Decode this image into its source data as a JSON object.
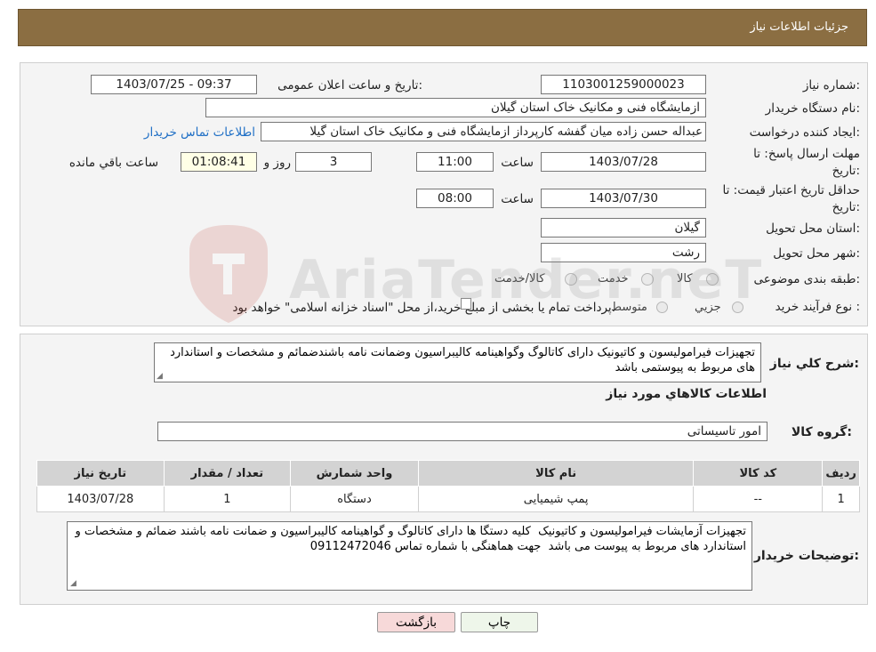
{
  "header": {
    "title": "جزئیات اطلاعات نیاز"
  },
  "form": {
    "need_number_label": "شماره نیاز:",
    "need_number": "1103001259000023",
    "announce_label": "تاریخ و ساعت اعلان عمومی:",
    "announce_value": "1403/07/25 - 09:37",
    "buyer_org_label": "نام دستگاه خریدار:",
    "buyer_org": "ازمایشگاه فنی و مکانیک خاک استان گیلان",
    "creator_label": "ایجاد کننده درخواست:",
    "creator": "عبداله حسن زاده میان گفشه کارپرداز ازمایشگاه فنی و مکانیک خاک استان گیلا",
    "contact_link": "اطلاعات تماس خریدار",
    "deadline_label_1": "مهلت ارسال پاسخ: تا",
    "deadline_label_2": "تاریخ:",
    "deadline_date": "1403/07/28",
    "time_label": "ساعت",
    "deadline_time": "11:00",
    "days_value": "3",
    "days_label": "روز و",
    "remaining_time": "01:08:41",
    "remaining_label": "ساعت باقي مانده",
    "validity_label_1": "حداقل تاریخ اعتبار قیمت: تا",
    "validity_label_2": "تاریخ:",
    "validity_date": "1403/07/30",
    "validity_time": "08:00",
    "province_label": "استان محل تحویل:",
    "province": "گیلان",
    "city_label": "شهر محل تحویل:",
    "city": "رشت",
    "category_label": "طبقه بندی موضوعی:",
    "category_options": [
      "کالا",
      "خدمت",
      "کالا/خدمت"
    ],
    "process_label": "نوع فرآیند خرید :",
    "process_options": [
      "جزیي",
      "متوسط"
    ],
    "process_note": "پرداخت تمام یا بخشی از مبلغ خرید،از محل \"اسناد خزانه اسلامی\" خواهد بود."
  },
  "details": {
    "summary_label": "شرح کلي نياز:",
    "summary": "تجهیزات فیرامولیسون و کاتیونیک دارای کاتالوگ وگواهینامه کالیبراسیون وضمانت نامه باشندضمائم و مشخصات و استاندارد های مربوط به پیوستمی باشد",
    "goods_info_title": "اطلاعات کالاهاي مورد نياز",
    "goods_group_label": "گروه کالا:",
    "goods_group": "امور تاسیساتی",
    "table": {
      "headers": [
        "رديف",
        "کد کالا",
        "نام کالا",
        "واحد شمارش",
        "تعداد / مقدار",
        "تاریخ نیاز"
      ],
      "rows": [
        [
          "1",
          "--",
          "پمپ شیمیایی",
          "دستگاه",
          "1",
          "1403/07/28"
        ]
      ]
    },
    "buyer_notes_label": "توضیحات خریدار:",
    "buyer_notes": "تجهیزات آزمایشات فیرامولیسون و کاتیونیک  کلیه دستگا ها دارای کاتالوگ و گواهینامه کالیبراسیون و ضمانت نامه باشند ضمائم و مشخصات و استاندارد های مربوط به پیوست می باشد  جهت هماهنگی با شماره تماس 09112472046"
  },
  "buttons": {
    "print": "چاپ",
    "back": "بازگشت"
  },
  "watermark": {
    "text": "AriaTender.neT"
  },
  "colors": {
    "header_bg": "#8b6e42",
    "link": "#1f6fc5",
    "back_button": "#f7d9d9",
    "print_button": "#eef6ea"
  }
}
